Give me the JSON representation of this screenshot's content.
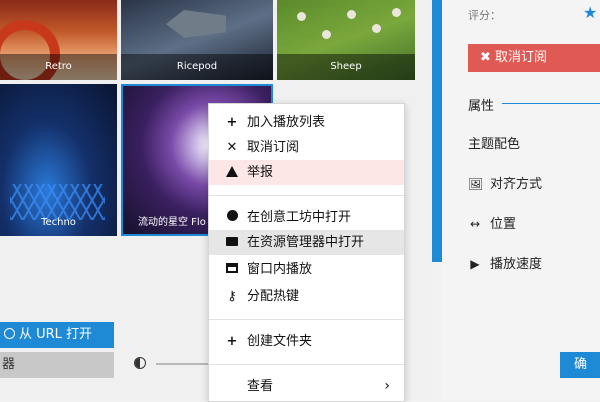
{
  "tiles": [
    {
      "name": "Retro"
    },
    {
      "name": "Ricepod"
    },
    {
      "name": "Sheep"
    },
    {
      "name": "Techno"
    },
    {
      "name": "流动的星空 Flo"
    }
  ],
  "left": {
    "url_button": "从 URL 打开",
    "gray_button": "器"
  },
  "context_menu": {
    "items": [
      {
        "icon": "+",
        "label": "加入播放列表"
      },
      {
        "icon": "✕",
        "label": "取消订阅"
      },
      {
        "icon": "warning",
        "label": "举报"
      },
      {
        "icon": "steam",
        "label": "在创意工坊中打开"
      },
      {
        "icon": "folder",
        "label": "在资源管理器中打开"
      },
      {
        "icon": "window",
        "label": "窗口内播放"
      },
      {
        "icon": "key",
        "label": "分配热键"
      },
      {
        "icon": "+",
        "label": "创建文件夹"
      },
      {
        "icon": "",
        "label": "查看"
      }
    ],
    "view_chevron": "›"
  },
  "right": {
    "rating_label": "评分：",
    "rating_star": "★",
    "unsubscribe": "✖ 取消订阅",
    "section_title": "属性",
    "props": [
      {
        "icon": "",
        "label": "主题配色"
      },
      {
        "icon": "🖼",
        "label": "对齐方式"
      },
      {
        "icon": "↔",
        "label": "位置"
      },
      {
        "icon": "▶",
        "label": "播放速度"
      }
    ],
    "ok_button": "确"
  },
  "colors": {
    "accent": "#1e8ad6",
    "danger": "#e05a55",
    "warn_highlight": "#fce6e6"
  }
}
